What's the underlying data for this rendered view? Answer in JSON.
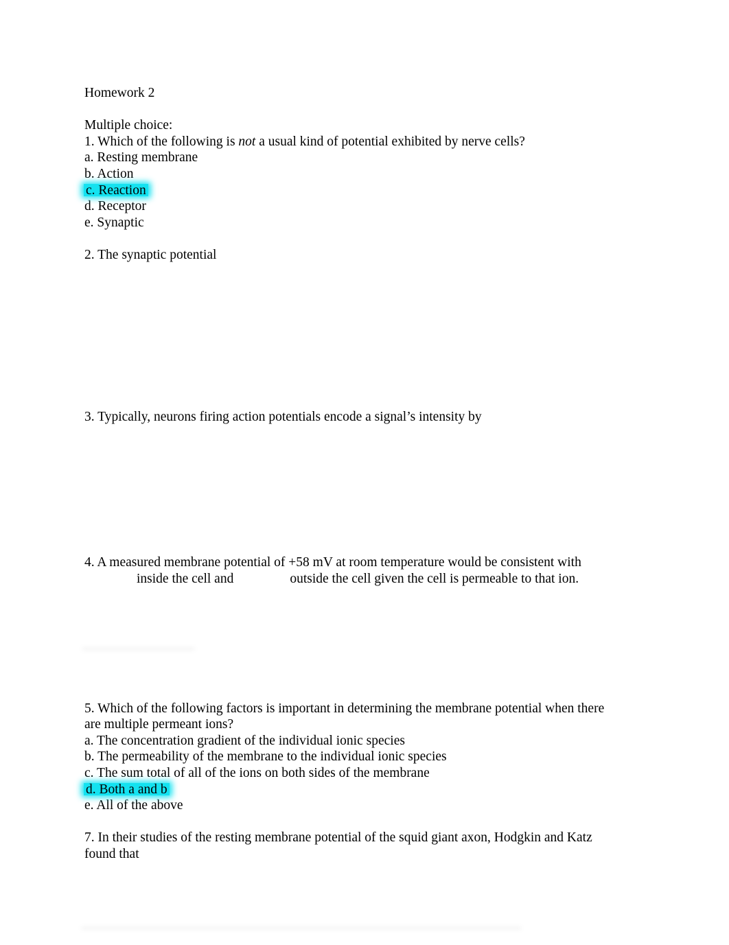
{
  "document": {
    "title": "Homework 2",
    "section_label": "Multiple choice:",
    "highlight_color": "#14e2f0",
    "text_color": "#000000",
    "page_background": "#ffffff"
  },
  "questions": [
    {
      "number": "1.",
      "stem_before_italic": "1. Which of the following is ",
      "stem_italic": "not",
      "stem_after_italic": " a usual kind of potential exhibited by nerve cells?",
      "options": [
        {
          "label": "a. Resting membrane",
          "highlighted": false
        },
        {
          "label": "b. Action",
          "highlighted": false
        },
        {
          "label": "c. Reaction",
          "highlighted": true
        },
        {
          "label": "d. Receptor",
          "highlighted": false
        },
        {
          "label": "e. Synaptic",
          "highlighted": false
        }
      ]
    },
    {
      "number": "2.",
      "stem": "2. The synaptic potential",
      "answer_blank_lines": 8
    },
    {
      "number": "3.",
      "stem": "3. Typically, neurons firing action potentials encode a signal’s intensity by",
      "answer_blank_lines": 7
    },
    {
      "number": "4.",
      "line_1": "4. A measured membrane potential of +58 mV at room temperature would be consistent with",
      "line_2_part_1": "inside the cell and",
      "line_2_part_2": "outside the cell given the cell is permeable to that ion.",
      "answer_blank_lines": 5
    },
    {
      "number": "5.",
      "stem_line_1": "5. Which of the following factors is important in determining the membrane potential when there",
      "stem_line_2": "are multiple permeant ions?",
      "options": [
        {
          "label": "a. The concentration gradient of the individual ionic species",
          "highlighted": false
        },
        {
          "label": "b. The permeability of the membrane to the individual ionic species",
          "highlighted": false
        },
        {
          "label": "c. The sum total of all of the ions on both sides of the membrane",
          "highlighted": false
        },
        {
          "label": "d. Both a and b",
          "highlighted": true
        },
        {
          "label": "e. All of the above",
          "highlighted": false
        }
      ]
    },
    {
      "number": "7.",
      "stem_line_1": "7. In their studies of the resting membrane potential of the squid giant axon, Hodgkin and Katz",
      "stem_line_2": "found that"
    }
  ]
}
